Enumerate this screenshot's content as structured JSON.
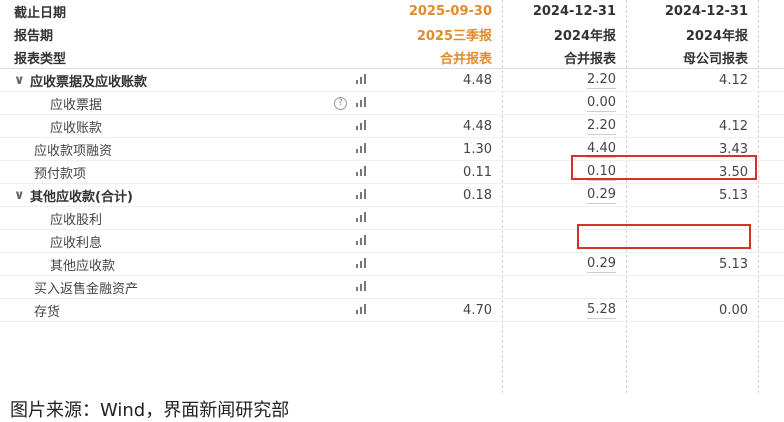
{
  "headers": {
    "labels": [
      "截止日期",
      "报告期",
      "报表类型"
    ],
    "col1": [
      "2025-09-30",
      "2025三季报",
      "合并报表"
    ],
    "col2": [
      "2024-12-31",
      "2024年报",
      "合并报表"
    ],
    "col3": [
      "2024-12-31",
      "2024年报",
      "母公司报表"
    ]
  },
  "rows": [
    {
      "label": "应收票据及应收账款",
      "bold": true,
      "toggle": "∨",
      "indent": 0,
      "v1": "4.48",
      "v2": "2.20",
      "v3": "4.12"
    },
    {
      "label": "应收票据",
      "bold": false,
      "indent": 2,
      "help": "?",
      "v1": "",
      "v2": "0.00",
      "v3": ""
    },
    {
      "label": "应收账款",
      "bold": false,
      "indent": 2,
      "v1": "4.48",
      "v2": "2.20",
      "v3": "4.12"
    },
    {
      "label": "应收款项融资",
      "bold": false,
      "indent": 1,
      "v1": "1.30",
      "v2": "4.40",
      "v3": "3.43"
    },
    {
      "label": "预付款项",
      "bold": false,
      "indent": 1,
      "v1": "0.11",
      "v2": "0.10",
      "v3": "3.50"
    },
    {
      "label": "其他应收款(合计)",
      "bold": true,
      "toggle": "∨",
      "indent": 0,
      "v1": "0.18",
      "v2": "0.29",
      "v3": "5.13"
    },
    {
      "label": "应收股利",
      "bold": false,
      "indent": 2,
      "v1": "",
      "v2": "",
      "v3": ""
    },
    {
      "label": "应收利息",
      "bold": false,
      "indent": 2,
      "v1": "",
      "v2": "",
      "v3": ""
    },
    {
      "label": "其他应收款",
      "bold": false,
      "indent": 2,
      "v1": "",
      "v2": "0.29",
      "v3": "5.13"
    },
    {
      "label": "买入返售金融资产",
      "bold": false,
      "indent": 1,
      "v1": "",
      "v2": "",
      "v3": ""
    },
    {
      "label": "存货",
      "bold": false,
      "indent": 1,
      "v1": "4.70",
      "v2": "5.28",
      "v3": "0.00"
    }
  ],
  "chart_icon": "bar-chart-icon",
  "help_icon": "question-circle-icon",
  "highlight_color": "#d93025",
  "accent_color": "#e38a2b",
  "caption": "图片来源：Wind，界面新闻研究部"
}
